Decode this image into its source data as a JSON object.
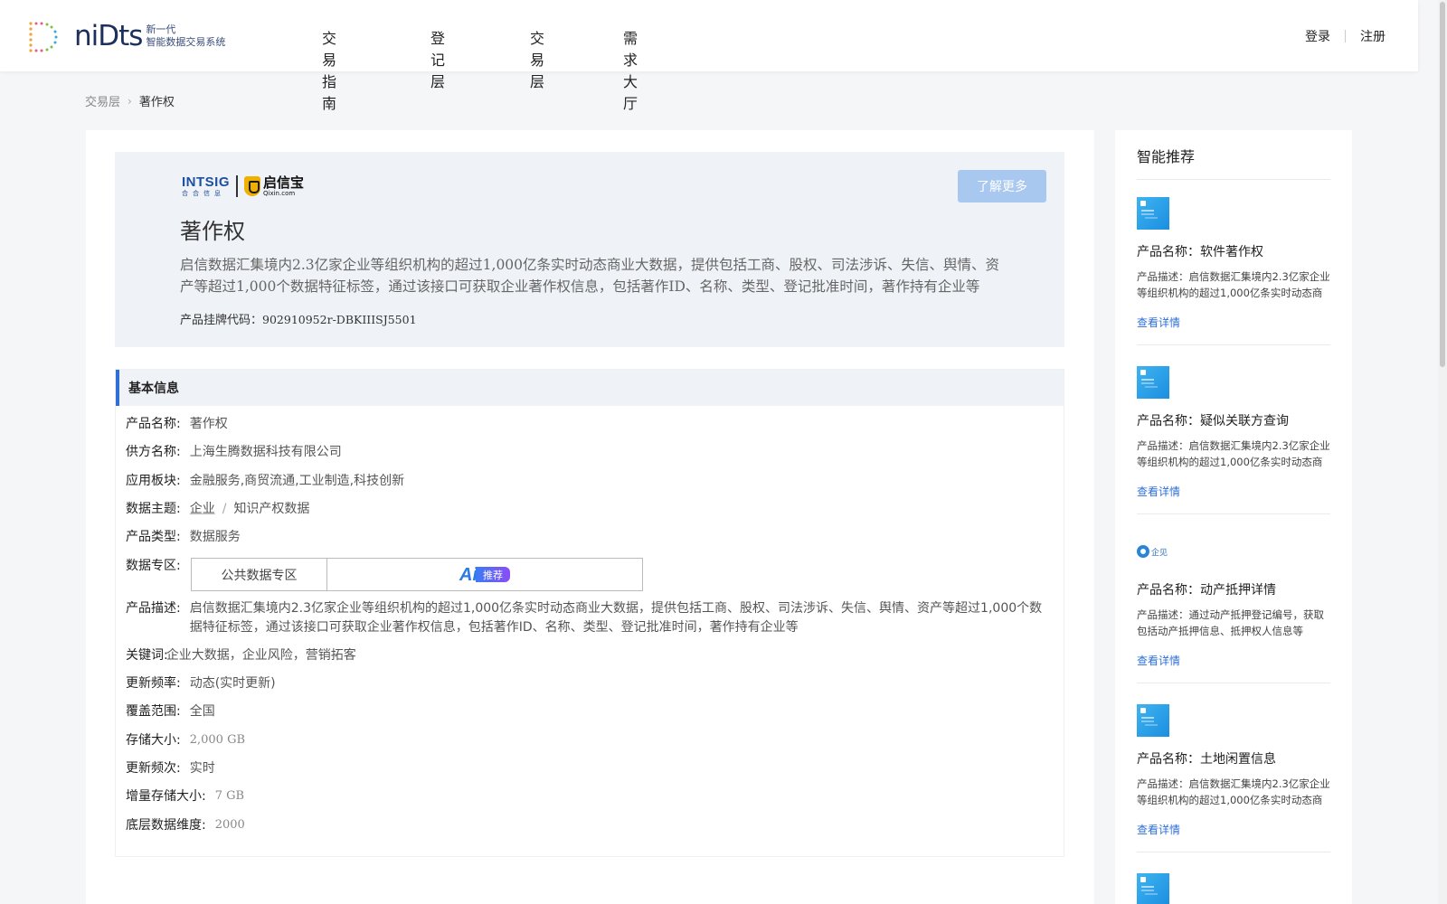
{
  "header": {
    "brand_word": "niDts",
    "brand_sub_line1": "新一代",
    "brand_sub_line2": "智能数据交易系统",
    "nav": [
      "交易指南",
      "登记层",
      "交易层",
      "需求大厅"
    ],
    "login": "登录",
    "register": "注册"
  },
  "breadcrumb": {
    "parent": "交易层",
    "current": "著作权"
  },
  "hero": {
    "logo_intsig": "INTSIG",
    "logo_intsig_sub": "合合信息",
    "logo_qixin_cn": "启信宝",
    "logo_qixin_en": "Qixin.com",
    "title": "著作权",
    "description": "启信数据汇集境内2.3亿家企业等组织机构的超过1,000亿条实时动态商业大数据，提供包括工商、股权、司法涉诉、失信、舆情、资产等超过1,000个数据特征标签，通过该接口可获取企业著作权信息，包括著作ID、名称、类型、登记批准时间，著作持有企业等",
    "code_label": "产品挂牌代码：",
    "code_value": "902910952r-DBKIIISJ5501",
    "learn_more": "了解更多"
  },
  "basic": {
    "section_title": "基本信息",
    "product_name_label": "产品名称:",
    "product_name": "著作权",
    "supplier_label": "供方名称:",
    "supplier": "上海生腾数据科技有限公司",
    "sector_label": "应用板块:",
    "sector": "金融服务,商贸流通,工业制造,科技创新",
    "topic_label": "数据主题:",
    "topic_1": "企业",
    "topic_sep": "/",
    "topic_2": "知识产权数据",
    "type_label": "产品类型:",
    "type": "数据服务",
    "zone_label": "数据专区:",
    "zone_name": "公共数据专区",
    "ai_text": "Ai",
    "ai_tag": "推荐",
    "desc_label": "产品描述:",
    "desc": "启信数据汇集境内2.3亿家企业等组织机构的超过1,000亿条实时动态商业大数据，提供包括工商、股权、司法涉诉、失信、舆情、资产等超过1,000个数据特征标签，通过该接口可获取企业著作权信息，包括著作ID、名称、类型、登记批准时间，著作持有企业等",
    "keywords_label": "关键词:",
    "keywords": "企业大数据，企业风险，营销拓客",
    "freq_label": "更新频率:",
    "freq": "动态(实时更新)",
    "coverage_label": "覆盖范围:",
    "coverage": "全国",
    "storage_label": "存储大小:",
    "storage": "2,000 GB",
    "update_times_label": "更新频次:",
    "update_times": "实时",
    "incr_label": "增量存储大小:",
    "incr": "7 GB",
    "dim_label": "底层数据维度:",
    "dim": "2000"
  },
  "side": {
    "title": "智能推荐",
    "items": [
      {
        "name": "产品名称：软件著作权",
        "desc": "产品描述：启信数据汇集境内2.3亿家企业等组织机构的超过1,000亿条实时动态商业大数据",
        "more": "查看详情"
      },
      {
        "name": "产品名称：疑似关联方查询",
        "desc": "产品描述：启信数据汇集境内2.3亿家企业等组织机构的超过1,000亿条实时动态商业大数据",
        "more": "查看详情"
      },
      {
        "name": "产品名称：动产抵押详情",
        "desc": "产品描述：通过动产抵押登记编号，获取包括动产抵押信息、抵押权人信息等",
        "more": "查看详情",
        "logo": "企见"
      },
      {
        "name": "产品名称：土地闲置信息",
        "desc": "产品描述：启信数据汇集境内2.3亿家企业等组织机构的超过1,000亿条实时动态商业大数据",
        "more": "查看详情"
      }
    ]
  },
  "colors": {
    "accent": "#2f6fd6",
    "button": "#a9c8f0",
    "hero_bg": "#eff2f6"
  }
}
